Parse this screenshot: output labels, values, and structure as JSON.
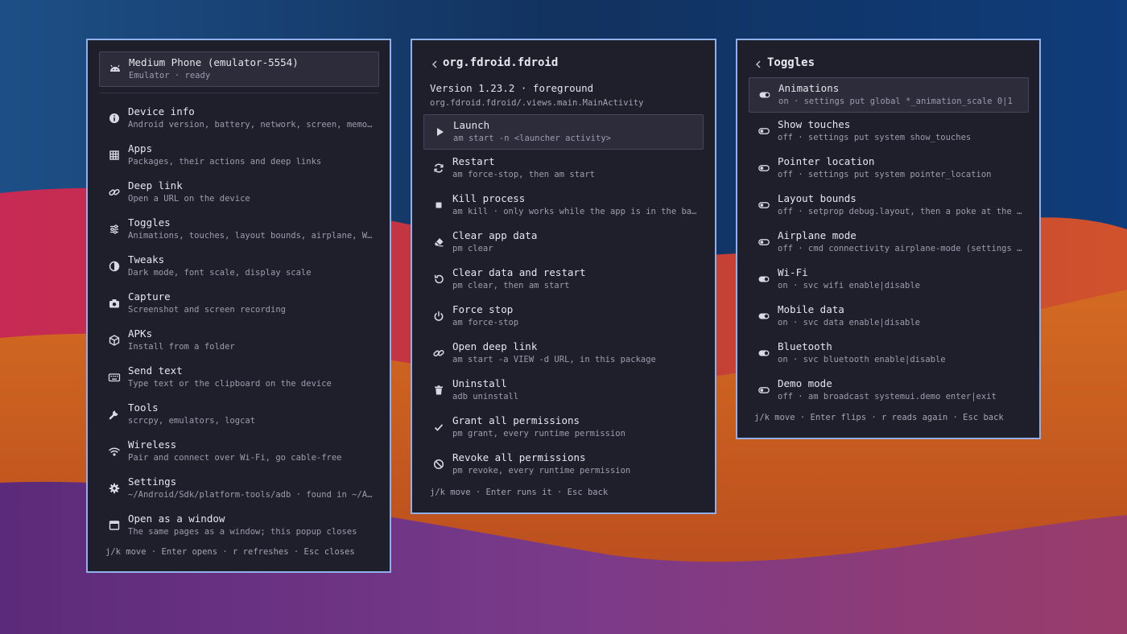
{
  "launcher": {
    "device": {
      "title": "Medium Phone (emulator-5554)",
      "subtitle": "Emulator · ready",
      "icon": "android-icon"
    },
    "items": [
      {
        "title": "Device info",
        "subtitle": "Android version, battery, network, screen, memory…",
        "icon": "info-icon"
      },
      {
        "title": "Apps",
        "subtitle": "Packages, their actions and deep links",
        "icon": "grid-icon"
      },
      {
        "title": "Deep link",
        "subtitle": "Open a URL on the device",
        "icon": "link-icon"
      },
      {
        "title": "Toggles",
        "subtitle": "Animations, touches, layout bounds, airplane, Wi-…",
        "icon": "sliders-icon"
      },
      {
        "title": "Tweaks",
        "subtitle": "Dark mode, font scale, display scale",
        "icon": "contrast-icon"
      },
      {
        "title": "Capture",
        "subtitle": "Screenshot and screen recording",
        "icon": "camera-icon"
      },
      {
        "title": "APKs",
        "subtitle": "Install from a folder",
        "icon": "package-icon"
      },
      {
        "title": "Send text",
        "subtitle": "Type text or the clipboard on the device",
        "icon": "keyboard-icon"
      },
      {
        "title": "Tools",
        "subtitle": "scrcpy, emulators, logcat",
        "icon": "wrench-icon"
      },
      {
        "title": "Wireless",
        "subtitle": "Pair and connect over Wi-Fi, go cable-free",
        "icon": "wifi-icon"
      },
      {
        "title": "Settings",
        "subtitle": "~/Android/Sdk/platform-tools/adb · found in ~/And…",
        "icon": "gear-icon"
      },
      {
        "title": "Open as a window",
        "subtitle": "The same pages as a window; this popup closes",
        "icon": "window-icon"
      }
    ],
    "hint": "j/k move · Enter opens · r refreshes · Esc closes"
  },
  "app": {
    "title": "org.fdroid.fdroid",
    "version": "Version 1.23.2 · foreground",
    "activity": "org.fdroid.fdroid/.views.main.MainActivity",
    "actions": [
      {
        "title": "Launch",
        "subtitle": "am start -n <launcher activity>",
        "icon": "play-icon"
      },
      {
        "title": "Restart",
        "subtitle": "am force-stop, then am start",
        "icon": "refresh-icon"
      },
      {
        "title": "Kill process",
        "subtitle": "am kill · only works while the app is in the back…",
        "icon": "stop-icon"
      },
      {
        "title": "Clear app data",
        "subtitle": "pm clear",
        "icon": "eraser-icon"
      },
      {
        "title": "Clear data and restart",
        "subtitle": "pm clear, then am start",
        "icon": "rotate-ccw-icon"
      },
      {
        "title": "Force stop",
        "subtitle": "am force-stop",
        "icon": "power-icon"
      },
      {
        "title": "Open deep link",
        "subtitle": "am start -a VIEW -d URL, in this package",
        "icon": "link-icon"
      },
      {
        "title": "Uninstall",
        "subtitle": "adb uninstall",
        "icon": "trash-icon"
      },
      {
        "title": "Grant all permissions",
        "subtitle": "pm grant, every runtime permission",
        "icon": "check-icon"
      },
      {
        "title": "Revoke all permissions",
        "subtitle": "pm revoke, every runtime permission",
        "icon": "ban-icon"
      }
    ],
    "hint": "j/k move · Enter runs it · Esc back"
  },
  "toggles": {
    "title": "Toggles",
    "items": [
      {
        "title": "Animations",
        "subtitle": "on · settings put global *_animation_scale 0|1",
        "state": "on"
      },
      {
        "title": "Show touches",
        "subtitle": "off · settings put system show_touches",
        "state": "off"
      },
      {
        "title": "Pointer location",
        "subtitle": "off · settings put system pointer_location",
        "state": "off"
      },
      {
        "title": "Layout bounds",
        "subtitle": "off · setprop debug.layout, then a poke at the ac…",
        "state": "off"
      },
      {
        "title": "Airplane mode",
        "subtitle": "off · cmd connectivity airplane-mode (settings pu…",
        "state": "off"
      },
      {
        "title": "Wi-Fi",
        "subtitle": "on · svc wifi enable|disable",
        "state": "on"
      },
      {
        "title": "Mobile data",
        "subtitle": "on · svc data enable|disable",
        "state": "on"
      },
      {
        "title": "Bluetooth",
        "subtitle": "on · svc bluetooth enable|disable",
        "state": "on"
      },
      {
        "title": "Demo mode",
        "subtitle": "off · am broadcast systemui.demo enter|exit",
        "state": "off"
      }
    ],
    "hint": "j/k move · Enter flips · r reads again · Esc back"
  },
  "colors": {
    "panel_bg": "#1f1f2c",
    "panel_border": "#8fb0ea",
    "selected_bg": "#2c2c3a"
  }
}
